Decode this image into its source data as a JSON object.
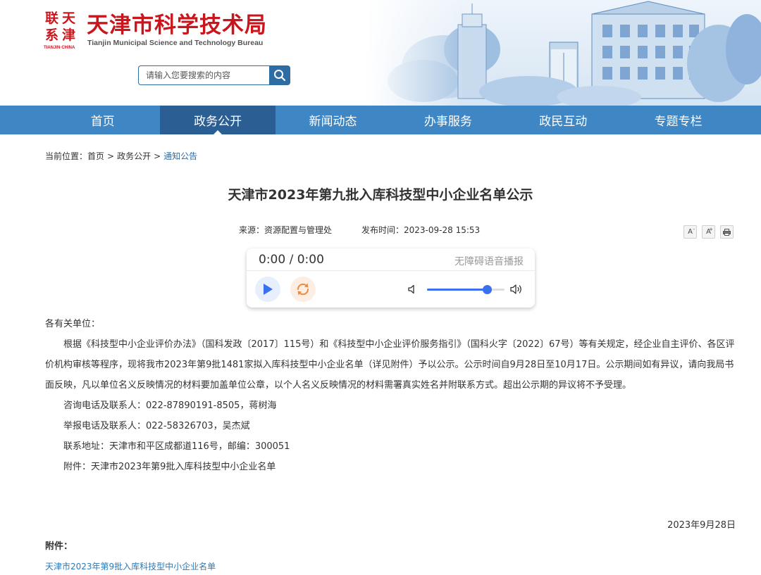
{
  "site": {
    "emblem_chars": [
      "联",
      "天",
      "系",
      "津"
    ],
    "emblem_sub": "TIANJIN·CHINA",
    "title": "天津市科学技术局",
    "title_en": "Tianjin Municipal Science and Technology Bureau",
    "brand_color": "#c9161d"
  },
  "search": {
    "placeholder": "请输入您要搜索的内容",
    "button_icon": "search-icon"
  },
  "nav": {
    "items": [
      {
        "label": "首页"
      },
      {
        "label": "政务公开",
        "active": true
      },
      {
        "label": "新闻动态"
      },
      {
        "label": "办事服务"
      },
      {
        "label": "政民互动"
      },
      {
        "label": "专题专栏"
      }
    ],
    "color": "#3f86c4",
    "active_color": "#2b5f94"
  },
  "breadcrumb": {
    "prefix": "当前位置：",
    "items": [
      "首页",
      "政务公开",
      "通知公告"
    ],
    "separator": ">"
  },
  "article": {
    "title": "天津市2023年第九批入库科技型中小企业名单公示",
    "source": "来源：资源配置与管理处",
    "published": "发布时间：2023-09-28 15:53",
    "tools": {
      "font_decrease": "A",
      "font_increase": "A",
      "decrease_mark": "-",
      "increase_mark": "+",
      "print_icon": "printer-icon"
    }
  },
  "player": {
    "time": "0:00 / 0:00",
    "label": "无障碍语音播报",
    "volume_percent": 77,
    "accent": "#3a6ff0",
    "loop_color": "#f08a3c"
  },
  "content": {
    "salutation": "各有关单位：",
    "paragraph": "根据《科技型中小企业评价办法》（国科发政〔2017〕115号）和《科技型中小企业评价服务指引》（国科火字〔2022〕67号）等有关规定，经企业自主评价、各区评价机构审核等程序，现将我市2023年第9批1481家拟入库科技型中小企业名单（详见附件）予以公示。公示时间自9月28日至10月17日。公示期间如有异议，请向我局书面反映，凡以单位名义反映情况的材料要加盖单位公章，以个人名义反映情况的材料需署真实姓名并附联系方式。超出公示期的异议将不予受理。",
    "consult": "咨询电话及联系人：022-87890191-8505，蒋树海",
    "report": "举报电话及联系人：022-58326703，吴杰斌",
    "address": "联系地址：天津市和平区成都道116号，邮编：300051",
    "attachment_line": "附件：天津市2023年第9批入库科技型中小企业名单",
    "date": "2023年9月28日",
    "attachment_heading": "附件：",
    "attachment_link": "天津市2023年第9批入库科技型中小企业名单"
  }
}
